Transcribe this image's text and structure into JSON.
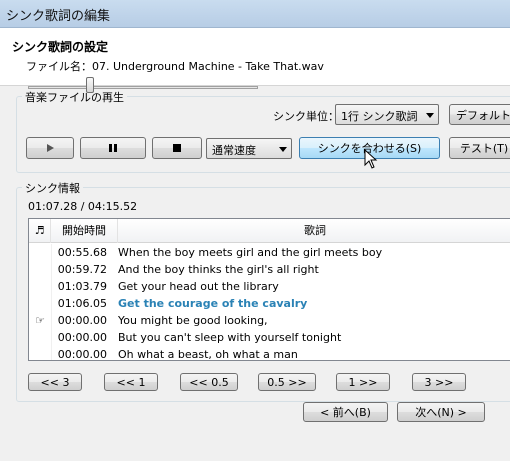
{
  "window": {
    "title": "シンク歌詞の編集"
  },
  "header": {
    "title": "シンク歌詞の設定",
    "file": "ファイル名：07. Underground Machine - Take That.wav"
  },
  "playback": {
    "group_label": "音楽ファイルの再生",
    "sync_unit_label": "シンク単位：",
    "sync_unit_value": "1行 シンク歌詞",
    "default_button": "デフォルト(F",
    "speed_value": "通常速度",
    "sync_button": "シンクを合わせる(S)",
    "test_button": "テスト(T)"
  },
  "sync_info": {
    "group_label": "シンク情報",
    "position": "01:07.28 / 04:15.52",
    "columns": [
      "♬",
      "開始時間",
      "歌詞"
    ],
    "rows": [
      {
        "mark": "",
        "time": "00:55.68",
        "lyric": "When the boy meets girl and the girl meets boy",
        "highlight": false
      },
      {
        "mark": "",
        "time": "00:59.72",
        "lyric": "And the boy thinks the girl's all right",
        "highlight": false
      },
      {
        "mark": "",
        "time": "01:03.79",
        "lyric": "Get your head out the library",
        "highlight": false
      },
      {
        "mark": "",
        "time": "01:06.05",
        "lyric": "Get the courage of the cavalry",
        "highlight": true
      },
      {
        "mark": "☞",
        "time": "00:00.00",
        "lyric": "You might be good looking,",
        "highlight": false
      },
      {
        "mark": "",
        "time": "00:00.00",
        "lyric": "But you can't sleep with yourself tonight",
        "highlight": false
      },
      {
        "mark": "",
        "time": "00:00.00",
        "lyric": "Oh what a beast, oh what a man",
        "highlight": false
      }
    ]
  },
  "nav_buttons": [
    "<< 3",
    "<< 1",
    "<< 0.5",
    "0.5 >>",
    "1 >>",
    "3 >>"
  ],
  "footer": {
    "back": "< 前へ(B)",
    "next": "次へ(N) >"
  }
}
